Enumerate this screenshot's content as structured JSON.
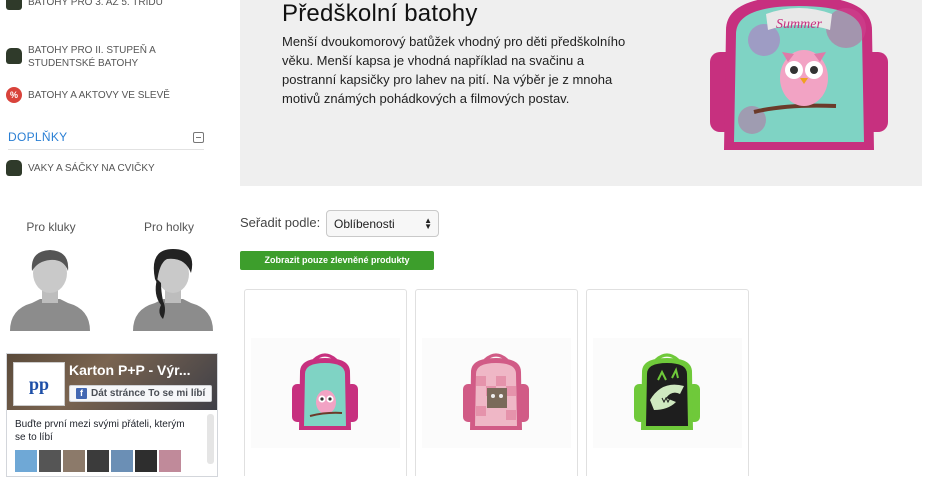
{
  "sidebar": {
    "categories": [
      {
        "label": "BATOHY PRO 3. AŽ 5. TŘÍDU",
        "icon": "backpack-icon"
      },
      {
        "label": "BATOHY PRO II. STUPEŇ A",
        "label2": "STUDENTSKÉ BATOHY",
        "icon": "backpack-icon"
      },
      {
        "label": "BATOHY A AKTOVY VE SLEVĚ",
        "icon": "sale-percent-icon",
        "icon_text": "%"
      }
    ],
    "addons_section": {
      "label": "DOPLŇKY",
      "icon": "collapse-minus-icon"
    },
    "addons_items": [
      {
        "label": "VAKY A SÁČKY NA CVIČKY",
        "icon": "bag-icon"
      }
    ],
    "gender": {
      "boys": "Pro kluky",
      "girls": "Pro holky"
    }
  },
  "facebook": {
    "page_name": "Karton P+P - Výr...",
    "like_button": "Dát stránce To se mi líbí",
    "prompt": "Buďte první mezi svými přáteli, kterým se to líbí",
    "logo_text": "pp"
  },
  "hero": {
    "title": "Předškolní batohy",
    "description": "Menší dvoukomorový batůžek vhodný pro děti předškolního věku. Menší kapsa je vhodná například na svačinu a postranní kapsičky pro lahev na pití. Na výběr je z mnoha motivů známých pohádkových a filmových postav.",
    "image_text": "Summer"
  },
  "sort": {
    "label": "Seřadit podle:",
    "selected": "Oblíbenosti"
  },
  "filter_button": "Zobrazit pouze zlevněné produkty",
  "products": [
    {
      "image": "owl-backpack",
      "colors": {
        "body": "#6fc9b9",
        "trim": "#c7307f"
      }
    },
    {
      "image": "cat-backpack",
      "colors": {
        "body": "#e7a9b8",
        "trim": "#d15b86"
      }
    },
    {
      "image": "dino-backpack",
      "colors": {
        "body": "#222222",
        "trim": "#6fc93a"
      }
    }
  ],
  "colors": {
    "accent_blue": "#2a7fd4",
    "sale_green": "#3d9e2c",
    "hero_bg": "#efefef"
  }
}
